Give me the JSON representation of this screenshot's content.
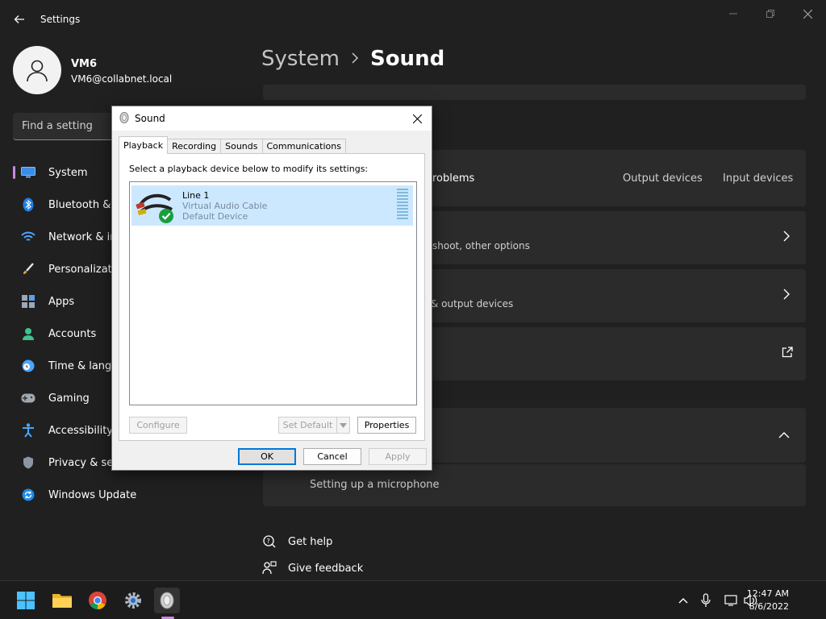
{
  "window": {
    "title": "Settings"
  },
  "profile": {
    "name": "VM6",
    "email": "VM6@collabnet.local"
  },
  "search": {
    "placeholder": "Find a setting"
  },
  "sidebar": {
    "items": [
      {
        "label": "System",
        "icon": "monitor-icon",
        "active": true
      },
      {
        "label": "Bluetooth &",
        "icon": "bluetooth-icon"
      },
      {
        "label": "Network & ir",
        "icon": "wifi-icon"
      },
      {
        "label": "Personalizati",
        "icon": "brush-icon"
      },
      {
        "label": "Apps",
        "icon": "apps-icon"
      },
      {
        "label": "Accounts",
        "icon": "person-icon"
      },
      {
        "label": "Time & langu",
        "icon": "clock-globe-icon"
      },
      {
        "label": "Gaming",
        "icon": "gamepad-icon"
      },
      {
        "label": "Accessibility",
        "icon": "accessibility-icon"
      },
      {
        "label": "Privacy & se",
        "icon": "shield-icon"
      },
      {
        "label": "Windows Update",
        "icon": "update-icon"
      }
    ]
  },
  "breadcrumb": {
    "parent": "System",
    "current": "Sound"
  },
  "main": {
    "troubleshoot_title": "roblems",
    "output_devices_link": "Output devices",
    "input_devices_link": "Input devices",
    "card2_sub": "shoot, other options",
    "card3_sub": "& output devices",
    "mic_help_link": "Setting up a microphone",
    "get_help": "Get help",
    "give_feedback": "Give feedback"
  },
  "dialog": {
    "title": "Sound",
    "tabs": [
      "Playback",
      "Recording",
      "Sounds",
      "Communications"
    ],
    "instruction": "Select a playback device below to modify its settings:",
    "device": {
      "name": "Line 1",
      "driver": "Virtual Audio Cable",
      "status": "Default Device"
    },
    "buttons": {
      "configure": "Configure",
      "set_default": "Set Default",
      "properties": "Properties",
      "ok": "OK",
      "cancel": "Cancel",
      "apply": "Apply"
    }
  },
  "taskbar": {
    "time": "12:47 AM",
    "date": "8/6/2022"
  },
  "colors": {
    "accent": "#c88be0",
    "background": "#202020",
    "card": "#2b2b2b",
    "selection": "#cce8ff"
  }
}
